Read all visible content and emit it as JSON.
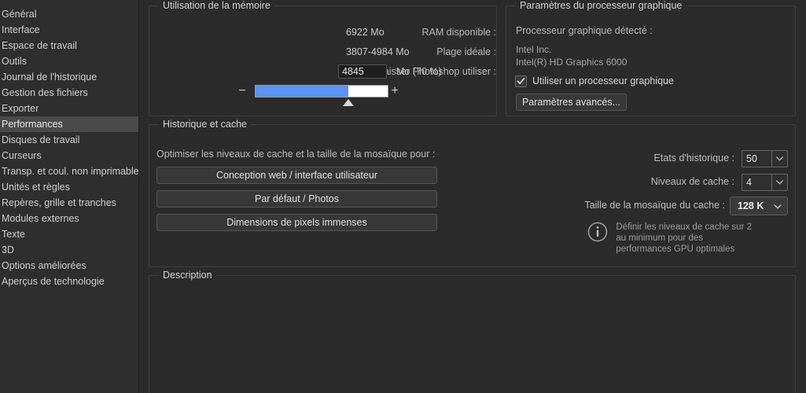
{
  "sidebar": {
    "items": [
      {
        "label": "Général",
        "selected": false
      },
      {
        "label": "Interface",
        "selected": false
      },
      {
        "label": "Espace de travail",
        "selected": false
      },
      {
        "label": "Outils",
        "selected": false
      },
      {
        "label": "Journal de l'historique",
        "selected": false
      },
      {
        "label": "Gestion des fichiers",
        "selected": false
      },
      {
        "label": "Exporter",
        "selected": false
      },
      {
        "label": "Performances",
        "selected": true
      },
      {
        "label": "Disques de travail",
        "selected": false
      },
      {
        "label": "Curseurs",
        "selected": false
      },
      {
        "label": "Transp. et coul. non imprimables",
        "selected": false
      },
      {
        "label": "Unités et règles",
        "selected": false
      },
      {
        "label": "Repères, grille et tranches",
        "selected": false
      },
      {
        "label": "Modules externes",
        "selected": false
      },
      {
        "label": "Texte",
        "selected": false
      },
      {
        "label": "3D",
        "selected": false
      },
      {
        "label": "Options améliorées",
        "selected": false
      },
      {
        "label": "Aperçus de technologie",
        "selected": false
      }
    ],
    "selected_color": "#4a4a4a"
  },
  "memory": {
    "legend": "Utilisation de la mémoire",
    "ram_label": "RAM disponible :",
    "ram_value": "6922 Mo",
    "range_label": "Plage idéale :",
    "range_value": "3807-4984 Mo",
    "use_label": "Laisser Photoshop utiliser :",
    "use_value": "4845",
    "use_unit": "Mo (70 %)",
    "slider": {
      "minus": "−",
      "plus": "+",
      "percent": 70,
      "fill_color": "#5b93f0",
      "track_color": "#ffffff"
    }
  },
  "gpu": {
    "legend": "Paramètres du processeur graphique",
    "detected_label": "Processeur graphique détecté :",
    "vendor": "Intel Inc.",
    "model": "Intel(R) HD Graphics 6000",
    "use_gpu_label": "Utiliser un processeur graphique",
    "use_gpu_checked": true,
    "advanced_button": "Paramètres avancés..."
  },
  "history_cache": {
    "legend": "Historique et cache",
    "optimize_label": "Optimiser les niveaux de cache et la taille de la mosaïque pour :",
    "preset_buttons": [
      "Conception web / interface utilisateur",
      "Par défaut / Photos",
      "Dimensions de pixels immenses"
    ],
    "fields": [
      {
        "label": "Etats d'historique :",
        "value": "50"
      },
      {
        "label": "Niveaux de cache :",
        "value": "4"
      },
      {
        "label": "Taille de la mosaïque du cache :",
        "value": "128 K"
      }
    ],
    "info_note": "Définir les niveaux de cache sur 2\nau minimum pour des\nperformances GPU optimales"
  },
  "description": {
    "legend": "Description"
  }
}
